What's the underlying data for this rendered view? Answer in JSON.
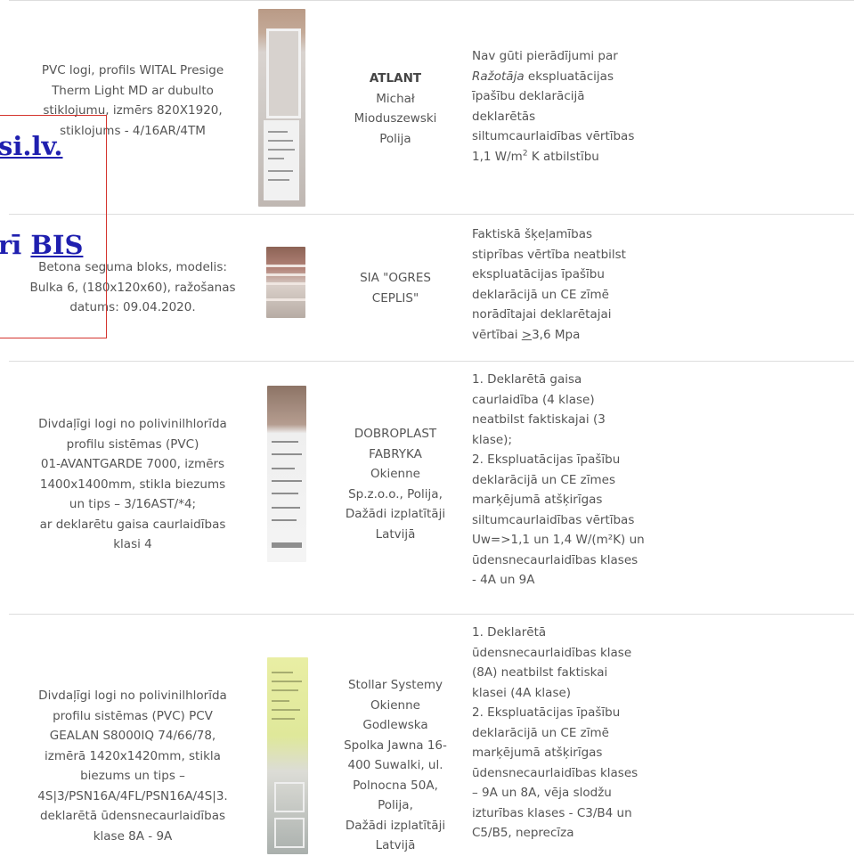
{
  "rows": [
    {
      "product": [
        "PVC logi, profils WITAL Presige",
        "Therm Light MD ar dubulto",
        "stiklojumu, izmērs 820X1920,",
        "stiklojums - 4/16AR/4TM"
      ],
      "manufacturer_bold": "ATLANT",
      "manufacturer": [
        "Michał",
        "Mioduszewski",
        "Polija"
      ],
      "issue": {
        "l1": "Nav gūti pierādījumi par",
        "l2_italic": "Ražotāja",
        "l2_rest": " ekspluatācijas",
        "l3": "īpašību deklarācijā",
        "l4": "deklarētās",
        "l5": "siltumcaurlaidības vērtības",
        "l6_pre": "1,1 W/m",
        "l6_sup": "2",
        "l6_post": " K atbilstību"
      }
    },
    {
      "product": [
        "Betona seguma bloks, modelis:",
        "Bulka 6, (180x120x60), ražošanas",
        "datums: 09.04.2020."
      ],
      "manufacturer": [
        "SIA \"OGRES",
        "CEPLIS\""
      ],
      "issue": {
        "l1": "Faktiskā šķeļamības",
        "l2": "stiprības vērtība neatbilst",
        "l3": "ekspluatācijas īpašību",
        "l4": "deklarācijā un CE zīmē",
        "l5": "norādītajai deklarētajai",
        "l6_pre": "vērtībai ",
        "l6_u": ">",
        "l6_post": "3,6 Mpa"
      }
    },
    {
      "product": [
        "Divdaļīgi logi no polivinilhlorīda",
        "profilu sistēmas (PVC)",
        "01-AVANTGARDE 7000, izmērs",
        "1400x1400mm, stikla biezums",
        "un tips – 3/16AST/*4;",
        "ar deklarētu gaisa caurlaidības",
        "klasi 4"
      ],
      "manufacturer": [
        "DOBROPLAST",
        "FABRYKA",
        "Okienne",
        "Sp.z.o.o., Polija,",
        "Dažādi izplatītāji",
        "Latvijā"
      ],
      "issue": [
        "1. Deklarētā gaisa",
        "caurlaidība (4 klase)",
        "neatbilst faktiskajai (3",
        "klase);",
        "2. Ekspluatācijas īpašību",
        "deklarācijā un CE zīmes",
        "marķējumā atšķirīgas",
        "siltumcaurlaidības vērtības",
        "Uw=>1,1 un 1,4 W/(m²K) un",
        "ūdensnecaurlaidības klases",
        "- 4A un 9A"
      ]
    },
    {
      "product": [
        "Divdaļīgi logi no polivinilhlorīda",
        "profilu sistēmas (PVC) PCV",
        "GEALAN S8000IQ 74/66/78,",
        "izmērā 1420x1420mm, stikla",
        "biezums un tips –",
        "4S|3/PSN16A/4FL/PSN16A/4S|3.",
        "deklarētā ūdensnecaurlaidības",
        "klase 8A - 9A"
      ],
      "manufacturer": [
        "Stollar Systemy",
        "Okienne",
        "Godlewska",
        "Spolka Jawna 16-",
        "400 Suwalki, ul.",
        "Polnocna 50A,",
        "Polija,",
        "Dažādi izplatītāji",
        "Latvijā"
      ],
      "issue": [
        "1. Deklarētā",
        "ūdensnecaurlaidības klase",
        "(8A) neatbilst  faktiskai",
        "klasei (4A klase)",
        "2. Ekspluatācijas īpašību",
        "deklarācijā un CE zīmē",
        "marķējumā atšķirīgas",
        "ūdensnecaurlaidības klases",
        "– 9A un 8A, vēja slodžu",
        "izturības klases - C3/B4 un",
        "C5/B5, neprecīza"
      ]
    }
  ],
  "overlay": {
    "link1": "si.lv.",
    "link2_prefix": "rī ",
    "link2": "BIS"
  },
  "colors": {
    "text": "#555555",
    "border": "#dddddd",
    "overlay_border": "#d4342e",
    "link": "#1f1faf"
  }
}
